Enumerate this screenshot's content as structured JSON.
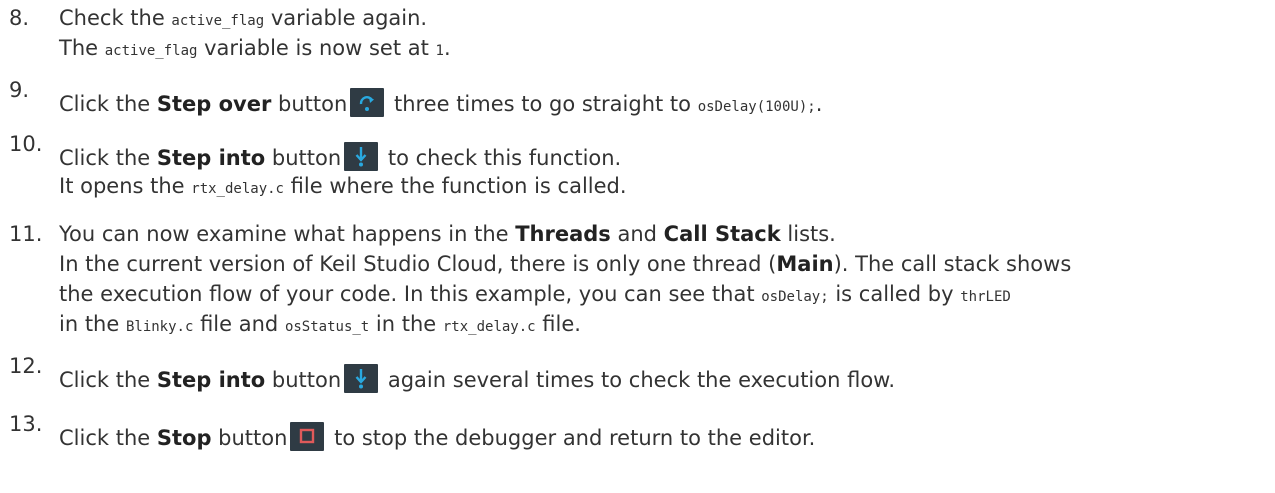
{
  "steps": [
    {
      "number": "8.",
      "lines": [
        {
          "t1": "Check the ",
          "code1": "active_flag",
          "t2": " variable again."
        },
        {
          "t1": "The ",
          "code1": "active_flag",
          "t2": " variable is now set at ",
          "code2": "1",
          "t3": "."
        }
      ]
    },
    {
      "number": "9.",
      "t1": "Click the ",
      "bold": "Step over",
      "t2": " button",
      "icon": "step-over-icon",
      "t3": " three times to go straight to ",
      "code": "osDelay(100U);",
      "t4": "."
    },
    {
      "number": "10.",
      "t1": "Click the ",
      "bold": "Step into",
      "t2": " button",
      "icon": "step-into-icon",
      "t3": " to check this function.",
      "line2": {
        "t1": "It opens the ",
        "code": "rtx_delay.c",
        "t2": " file where the function is called."
      }
    },
    {
      "number": "11.",
      "line1": {
        "t1": "You can now examine what happens in the ",
        "b1": "Threads",
        "t2": " and ",
        "b2": "Call Stack",
        "t3": " lists."
      },
      "line2": {
        "t1": "In the current version of Keil Studio Cloud, there is only one thread (",
        "b1": "Main",
        "t2": "). The call stack shows"
      },
      "line3": {
        "t1": "the execution flow of your code. In this example, you can see that ",
        "c1": "osDelay;",
        "t2": " is called by ",
        "c2": "thrLED"
      },
      "line4": {
        "t1": "in the ",
        "c1": "Blinky.c",
        "t2": " file and ",
        "c2": "osStatus_t",
        "t3": " in the ",
        "c3": "rtx_delay.c",
        "t4": " file."
      }
    },
    {
      "number": "12.",
      "t1": "Click the ",
      "bold": "Step into",
      "t2": " button",
      "icon": "step-into-icon",
      "t3": " again several times to check the execution flow."
    },
    {
      "number": "13.",
      "t1": "Click the ",
      "bold": "Stop",
      "t2": " button",
      "icon": "stop-icon",
      "t3": " to stop the debugger and return to the editor."
    }
  ],
  "icon_colors": {
    "background": "#2f3b44",
    "step": "#29a9e0",
    "stop": "#e05a5a"
  }
}
